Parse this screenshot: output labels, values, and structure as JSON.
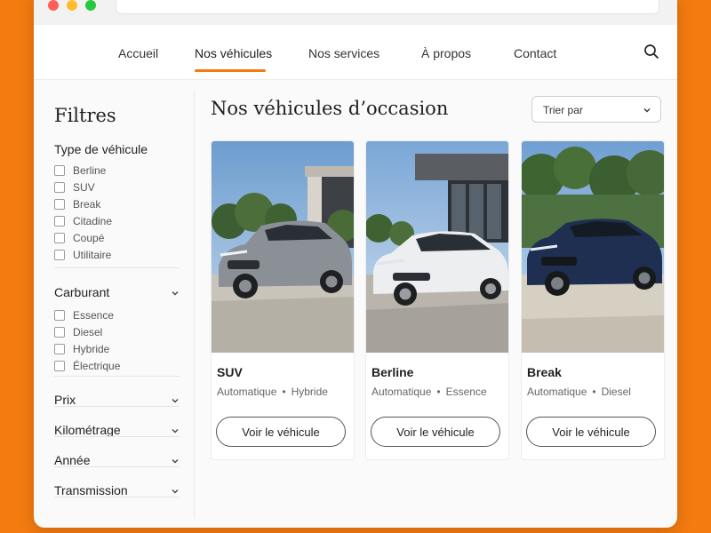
{
  "nav": {
    "items": [
      {
        "label": "Accueil"
      },
      {
        "label": "Nos véhicules"
      },
      {
        "label": "Nos services"
      },
      {
        "label": "À propos"
      },
      {
        "label": "Contact"
      }
    ],
    "active": "Nos véhicules"
  },
  "sidebar": {
    "title": "Filtres",
    "vehicle_type": {
      "title": "Type de véhicule",
      "options": [
        "Berline",
        "SUV",
        "Break",
        "Citadine",
        "Coupé",
        "Utilitaire"
      ]
    },
    "fuel": {
      "title": "Carburant",
      "options": [
        "Essence",
        "Diesel",
        "Hybride",
        "Électrique"
      ]
    },
    "collapsed_sections": [
      "Prix",
      "Kilométrage",
      "Année",
      "Transmission"
    ]
  },
  "main": {
    "title": "Nos véhicules d’occasion",
    "sort": {
      "label": "Trier par"
    },
    "cards": [
      {
        "title": "SUV",
        "transmission": "Automatique",
        "fuel": "Hybride",
        "button": "Voir le véhicule",
        "car_color": "#8b9096"
      },
      {
        "title": "Berline",
        "transmission": "Automatique",
        "fuel": "Essence",
        "button": "Voir le véhicule",
        "car_color": "#eceef0"
      },
      {
        "title": "Break",
        "transmission": "Automatique",
        "fuel": "Diesel",
        "button": "Voir le véhicule",
        "car_color": "#1f2f52"
      }
    ]
  },
  "colors": {
    "accent": "#f47b10",
    "background": "#f47b10"
  }
}
